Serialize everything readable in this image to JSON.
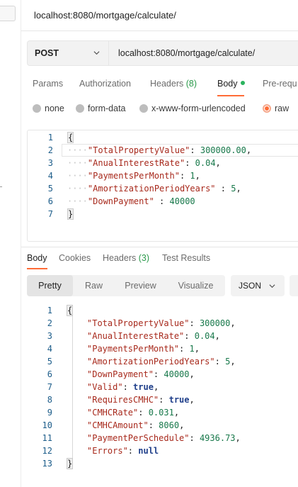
{
  "title_bar": {
    "url": "localhost:8080/mortgage/calculate/"
  },
  "request": {
    "method": "POST",
    "url": "localhost:8080/mortgage/calculate/",
    "tabs": [
      {
        "label": "Params"
      },
      {
        "label": "Authorization"
      },
      {
        "label": "Headers",
        "count": "(8)"
      },
      {
        "label": "Body"
      },
      {
        "label": "Pre-requ"
      }
    ],
    "body_types": [
      {
        "label": "none"
      },
      {
        "label": "form-data"
      },
      {
        "label": "x-www-form-urlencoded"
      },
      {
        "label": "raw"
      }
    ],
    "body_lines": [
      {
        "n": "1",
        "parts": [
          [
            "punc",
            "{"
          ]
        ]
      },
      {
        "n": "2",
        "parts": [
          [
            "ws",
            "····"
          ],
          [
            "key",
            "\"TotalPropertyValue\""
          ],
          [
            "punc",
            ": "
          ],
          [
            "num",
            "300000.00"
          ],
          [
            "punc",
            ","
          ]
        ]
      },
      {
        "n": "3",
        "parts": [
          [
            "ws",
            "····"
          ],
          [
            "key",
            "\"AnualInterestRate\""
          ],
          [
            "punc",
            ": "
          ],
          [
            "num",
            "0.04"
          ],
          [
            "punc",
            ","
          ]
        ]
      },
      {
        "n": "4",
        "parts": [
          [
            "ws",
            "····"
          ],
          [
            "key",
            "\"PaymentsPerMonth\""
          ],
          [
            "punc",
            ": "
          ],
          [
            "num",
            "1"
          ],
          [
            "punc",
            ","
          ]
        ]
      },
      {
        "n": "5",
        "parts": [
          [
            "ws",
            "····"
          ],
          [
            "key",
            "\"AmortizationPeriodYears\""
          ],
          [
            "punc",
            " : "
          ],
          [
            "num",
            "5"
          ],
          [
            "punc",
            ","
          ]
        ]
      },
      {
        "n": "6",
        "parts": [
          [
            "ws",
            "····"
          ],
          [
            "key",
            "\"DownPayment\""
          ],
          [
            "punc",
            " : "
          ],
          [
            "num",
            "40000"
          ]
        ]
      },
      {
        "n": "7",
        "parts": [
          [
            "punc",
            "}"
          ]
        ]
      }
    ]
  },
  "response": {
    "tabs": [
      {
        "label": "Body"
      },
      {
        "label": "Cookies"
      },
      {
        "label": "Headers",
        "count": "(3)"
      },
      {
        "label": "Test Results"
      }
    ],
    "views": [
      "Pretty",
      "Raw",
      "Preview",
      "Visualize"
    ],
    "format": "JSON",
    "lines": [
      {
        "n": "1",
        "parts": [
          [
            "punc",
            "{"
          ]
        ]
      },
      {
        "n": "2",
        "parts": [
          [
            "key",
            "\"TotalPropertyValue\""
          ],
          [
            "punc",
            ": "
          ],
          [
            "num",
            "300000"
          ],
          [
            "punc",
            ","
          ]
        ]
      },
      {
        "n": "3",
        "parts": [
          [
            "key",
            "\"AnualInterestRate\""
          ],
          [
            "punc",
            ": "
          ],
          [
            "num",
            "0.04"
          ],
          [
            "punc",
            ","
          ]
        ]
      },
      {
        "n": "4",
        "parts": [
          [
            "key",
            "\"PaymentsPerMonth\""
          ],
          [
            "punc",
            ": "
          ],
          [
            "num",
            "1"
          ],
          [
            "punc",
            ","
          ]
        ]
      },
      {
        "n": "5",
        "parts": [
          [
            "key",
            "\"AmortizationPeriodYears\""
          ],
          [
            "punc",
            ": "
          ],
          [
            "num",
            "5"
          ],
          [
            "punc",
            ","
          ]
        ]
      },
      {
        "n": "6",
        "parts": [
          [
            "key",
            "\"DownPayment\""
          ],
          [
            "punc",
            ": "
          ],
          [
            "num",
            "40000"
          ],
          [
            "punc",
            ","
          ]
        ]
      },
      {
        "n": "7",
        "parts": [
          [
            "key",
            "\"Valid\""
          ],
          [
            "punc",
            ": "
          ],
          [
            "kw",
            "true"
          ],
          [
            "punc",
            ","
          ]
        ]
      },
      {
        "n": "8",
        "parts": [
          [
            "key",
            "\"RequiresCMHC\""
          ],
          [
            "punc",
            ": "
          ],
          [
            "kw",
            "true"
          ],
          [
            "punc",
            ","
          ]
        ]
      },
      {
        "n": "9",
        "parts": [
          [
            "key",
            "\"CMHCRate\""
          ],
          [
            "punc",
            ": "
          ],
          [
            "num",
            "0.031"
          ],
          [
            "punc",
            ","
          ]
        ]
      },
      {
        "n": "10",
        "parts": [
          [
            "key",
            "\"CMHCAmount\""
          ],
          [
            "punc",
            ": "
          ],
          [
            "num",
            "8060"
          ],
          [
            "punc",
            ","
          ]
        ]
      },
      {
        "n": "11",
        "parts": [
          [
            "key",
            "\"PaymentPerSchedule\""
          ],
          [
            "punc",
            ": "
          ],
          [
            "num",
            "4936.73"
          ],
          [
            "punc",
            ","
          ]
        ]
      },
      {
        "n": "12",
        "parts": [
          [
            "key",
            "\"Errors\""
          ],
          [
            "punc",
            ": "
          ],
          [
            "kw",
            "null"
          ]
        ]
      },
      {
        "n": "13",
        "parts": [
          [
            "punc",
            "}"
          ]
        ]
      }
    ]
  },
  "colors": {
    "accent": "#ff6c37",
    "json_key": "#a7281b",
    "json_number": "#17784a",
    "json_keyword": "#1f3f8a",
    "count_green": "#2b9a4b"
  },
  "icons": {
    "method_dropdown": "chevron-down-icon",
    "format_dropdown": "chevron-down-icon",
    "wrap": "wrap-lines-icon"
  }
}
